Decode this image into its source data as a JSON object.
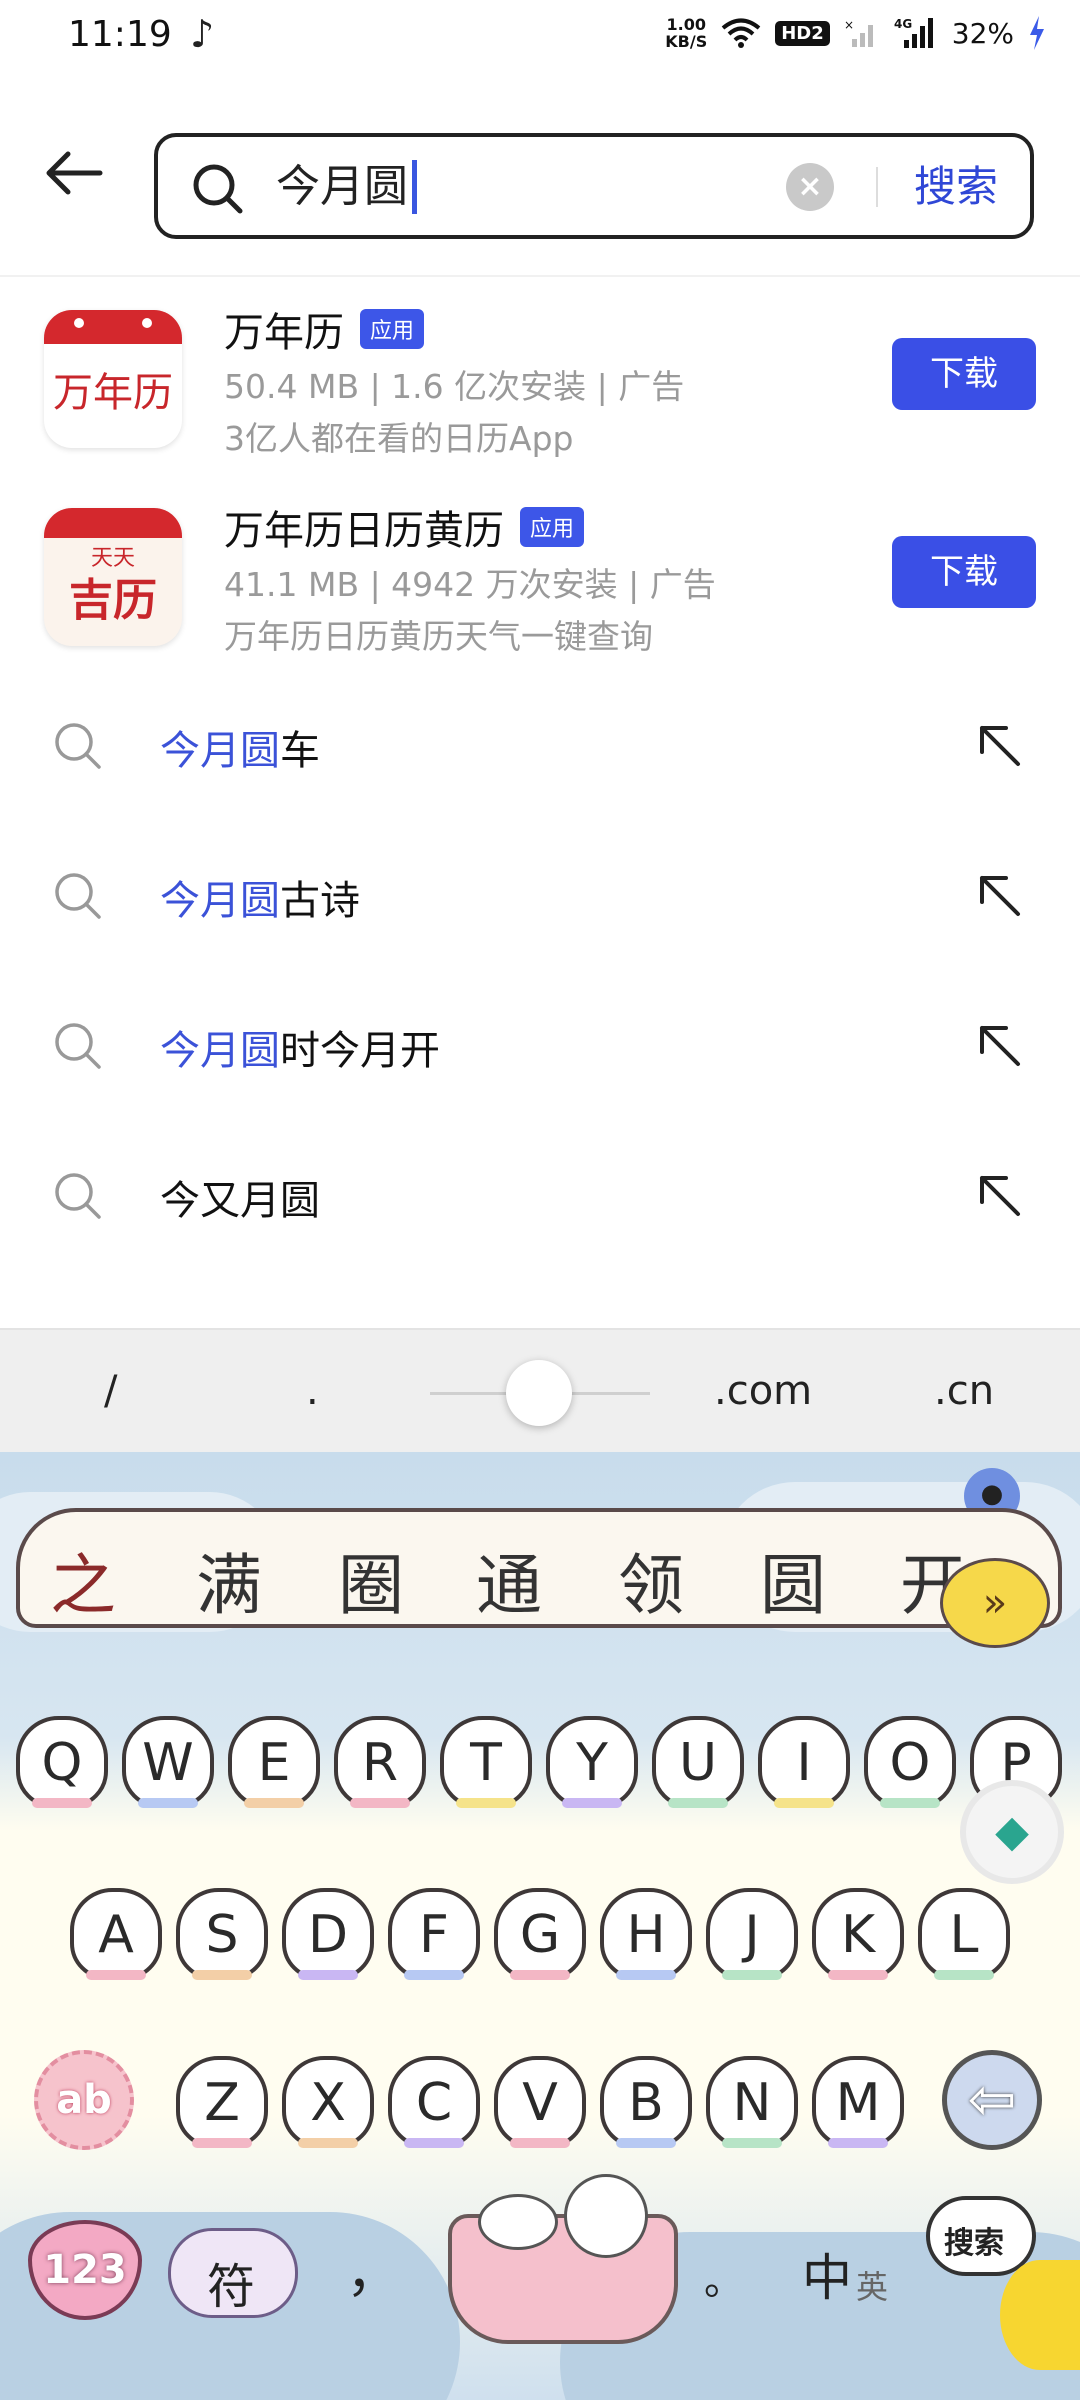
{
  "status_bar": {
    "time": "11:19",
    "music_icon": "music-note-icon",
    "net_speed_value": "1.00",
    "net_speed_unit": "KB/S",
    "hd_badge": "HD2",
    "network": "4G",
    "battery": "32%"
  },
  "search": {
    "query": "今月圆",
    "button_label": "搜索"
  },
  "apps": [
    {
      "name": "万年历",
      "tag": "应用",
      "meta": "50.4 MB | 1.6 亿次安装 | 广告",
      "desc": "3亿人都在看的日历App",
      "button": "下载",
      "icon_text": "万年历"
    },
    {
      "name": "万年历日历黄历",
      "tag": "应用",
      "meta": "41.1 MB | 4942 万次安装 | 广告",
      "desc": "万年历日历黄历天气一键查询",
      "button": "下载",
      "icon_top": "天天",
      "icon_main": "吉历"
    }
  ],
  "suggestions": [
    {
      "highlight": "今月圆",
      "rest": "车"
    },
    {
      "highlight": "今月圆",
      "rest": "古诗"
    },
    {
      "highlight": "今月圆",
      "rest": "时今月开"
    },
    {
      "highlight": "",
      "rest": "今又月圆"
    }
  ],
  "keyboard": {
    "quickbar": [
      "/",
      ".",
      ".com",
      ".cn"
    ],
    "candidates": [
      "之",
      "满",
      "圈",
      "通",
      "领",
      "圆",
      "开"
    ],
    "row1": [
      "Q",
      "W",
      "E",
      "R",
      "T",
      "Y",
      "U",
      "I",
      "O",
      "P"
    ],
    "row2": [
      "A",
      "S",
      "D",
      "F",
      "G",
      "H",
      "J",
      "K",
      "L"
    ],
    "row3": [
      "Z",
      "X",
      "C",
      "V",
      "B",
      "N",
      "M"
    ],
    "shift_label": "ab",
    "num_label": "123",
    "symbol_label": "符",
    "comma": "，",
    "period": "。",
    "lang_label_main": "中",
    "lang_label_sub": "英",
    "search_key_label": "搜索"
  },
  "colors": {
    "accent": "#3a4fe6",
    "highlight_text": "#3b52d8"
  }
}
